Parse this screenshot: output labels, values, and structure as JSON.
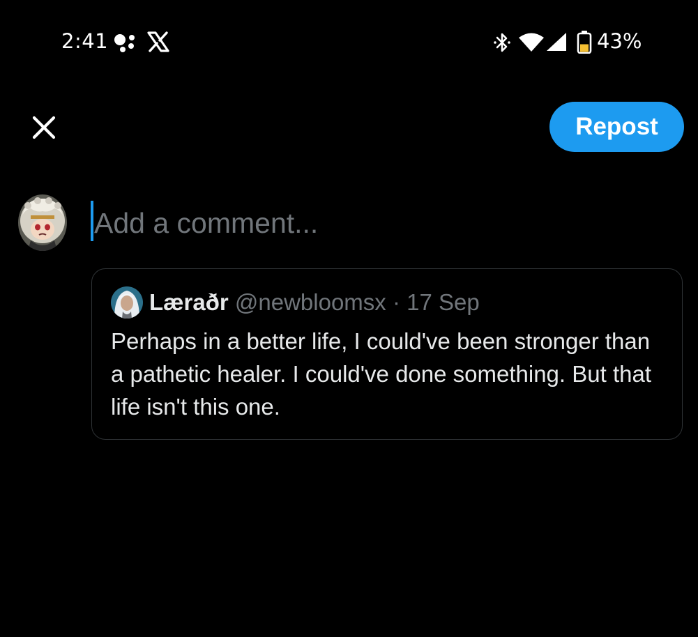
{
  "status_bar": {
    "time": "2:41",
    "battery_percent": "43%",
    "battery_level": 0.43,
    "icons": [
      "assistant-icon",
      "x-app-icon",
      "bluetooth-icon",
      "wifi-icon",
      "cellular-signal-icon",
      "battery-icon"
    ]
  },
  "top_bar": {
    "close_icon": "close-icon",
    "repost_label": "Repost"
  },
  "composer": {
    "placeholder": "Add a comment..."
  },
  "quoted_post": {
    "display_name": "Læraðr",
    "handle": "@newbloomsx",
    "separator": "·",
    "date": "17 Sep",
    "text": "Perhaps in a better life, I could've been stronger than a pathetic healer. I could've done something. But that life isn't this one."
  },
  "colors": {
    "background": "#000000",
    "accent": "#1d9bf0",
    "primary_text": "#e7e9ea",
    "secondary_text": "#71767b",
    "border": "#2f3336"
  }
}
